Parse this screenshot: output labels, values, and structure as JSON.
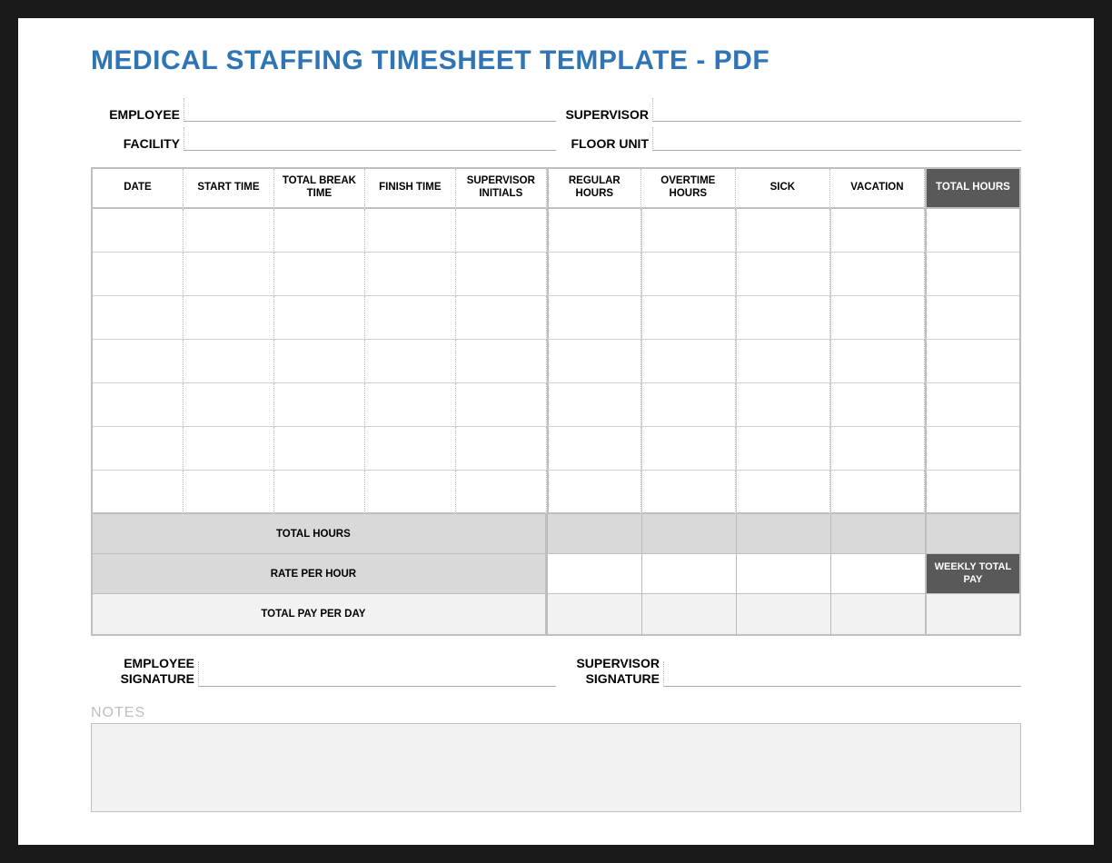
{
  "title": "MEDICAL STAFFING TIMESHEET TEMPLATE - PDF",
  "info": {
    "employee_label": "EMPLOYEE",
    "employee_value": "",
    "supervisor_label": "SUPERVISOR",
    "supervisor_value": "",
    "facility_label": "FACILITY",
    "facility_value": "",
    "floor_unit_label": "FLOOR UNIT",
    "floor_unit_value": ""
  },
  "columns": {
    "date": "DATE",
    "start_time": "START TIME",
    "total_break_time": "TOTAL BREAK TIME",
    "finish_time": "FINISH TIME",
    "supervisor_initials": "SUPERVISOR INITIALS",
    "regular_hours": "REGULAR HOURS",
    "overtime_hours": "OVERTIME HOURS",
    "sick": "SICK",
    "vacation": "VACATION",
    "total_hours": "TOTAL HOURS"
  },
  "rows": [
    {
      "date": "",
      "start_time": "",
      "total_break_time": "",
      "finish_time": "",
      "supervisor_initials": "",
      "regular_hours": "",
      "overtime_hours": "",
      "sick": "",
      "vacation": "",
      "total_hours": ""
    },
    {
      "date": "",
      "start_time": "",
      "total_break_time": "",
      "finish_time": "",
      "supervisor_initials": "",
      "regular_hours": "",
      "overtime_hours": "",
      "sick": "",
      "vacation": "",
      "total_hours": ""
    },
    {
      "date": "",
      "start_time": "",
      "total_break_time": "",
      "finish_time": "",
      "supervisor_initials": "",
      "regular_hours": "",
      "overtime_hours": "",
      "sick": "",
      "vacation": "",
      "total_hours": ""
    },
    {
      "date": "",
      "start_time": "",
      "total_break_time": "",
      "finish_time": "",
      "supervisor_initials": "",
      "regular_hours": "",
      "overtime_hours": "",
      "sick": "",
      "vacation": "",
      "total_hours": ""
    },
    {
      "date": "",
      "start_time": "",
      "total_break_time": "",
      "finish_time": "",
      "supervisor_initials": "",
      "regular_hours": "",
      "overtime_hours": "",
      "sick": "",
      "vacation": "",
      "total_hours": ""
    },
    {
      "date": "",
      "start_time": "",
      "total_break_time": "",
      "finish_time": "",
      "supervisor_initials": "",
      "regular_hours": "",
      "overtime_hours": "",
      "sick": "",
      "vacation": "",
      "total_hours": ""
    },
    {
      "date": "",
      "start_time": "",
      "total_break_time": "",
      "finish_time": "",
      "supervisor_initials": "",
      "regular_hours": "",
      "overtime_hours": "",
      "sick": "",
      "vacation": "",
      "total_hours": ""
    }
  ],
  "footer": {
    "total_hours_label": "TOTAL HOURS",
    "total_hours": {
      "regular": "",
      "overtime": "",
      "sick": "",
      "vacation": "",
      "total": ""
    },
    "rate_per_hour_label": "RATE PER HOUR",
    "rate_per_hour": {
      "regular": "",
      "overtime": "",
      "sick": "",
      "vacation": ""
    },
    "weekly_total_pay_label": "WEEKLY TOTAL PAY",
    "total_pay_per_day_label": "TOTAL PAY PER DAY",
    "total_pay_per_day": {
      "regular": "",
      "overtime": "",
      "sick": "",
      "vacation": "",
      "total": ""
    }
  },
  "signatures": {
    "employee_label_l1": "EMPLOYEE",
    "employee_label_l2": "SIGNATURE",
    "employee_value": "",
    "supervisor_label_l1": "SUPERVISOR",
    "supervisor_label_l2": "SIGNATURE",
    "supervisor_value": ""
  },
  "notes": {
    "label": "NOTES",
    "value": ""
  }
}
